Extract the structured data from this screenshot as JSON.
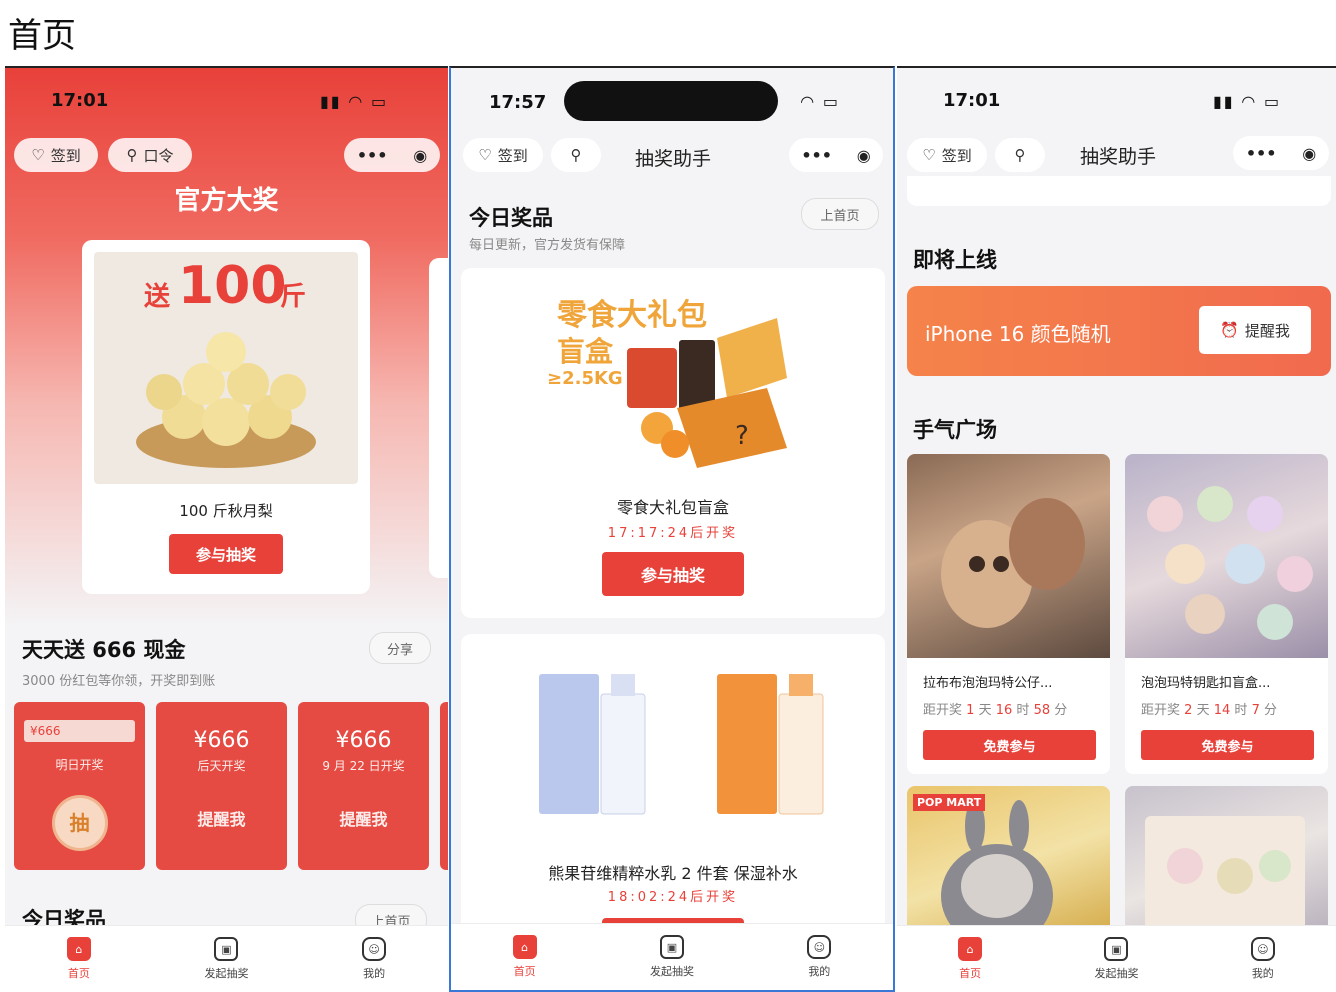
{
  "page_title": "首页",
  "phone1": {
    "status_time": "17:01",
    "nav_checkin": "签到",
    "nav_code": "口令",
    "header_title": "官方大奖",
    "prize_banner_prefix": "送",
    "prize_banner_amount": "100",
    "prize_banner_unit": "斤",
    "prize_name": "100 斤秋月梨",
    "join_label": "参与抽奖",
    "cash_title": "天天送 666 现金",
    "share_label": "分享",
    "cash_sub": "3000 份红包等你领，开奖即到账",
    "envelopes": [
      {
        "amount": "¥666",
        "sub": "明日开奖",
        "action": "抽"
      },
      {
        "amount": "¥666",
        "sub": "后天开奖",
        "action": "提醒我"
      },
      {
        "amount": "¥666",
        "sub": "9 月 22 日开奖",
        "action": "提醒我"
      }
    ],
    "today_title": "今日奖品",
    "today_pill": "上首页"
  },
  "phone2": {
    "status_time": "17:57",
    "nav_checkin": "签到",
    "nav_title": "抽奖助手",
    "today_title": "今日奖品",
    "today_pill": "上首页",
    "today_sub": "每日更新，官方发货有保障",
    "prize1_banner_line1": "零食大礼包",
    "prize1_banner_line2": "盲盒",
    "prize1_banner_weight": "≥2.5KG",
    "prize1_name": "零食大礼包盲盒",
    "prize1_countdown": "17:17:24后开奖",
    "join_label": "参与抽奖",
    "prize2_name": "熊果苷维精粹水乳 2 件套 保湿补水",
    "prize2_countdown": "18:02:24后开奖"
  },
  "phone3": {
    "status_time": "17:01",
    "nav_checkin": "签到",
    "nav_title": "抽奖助手",
    "upcoming_title": "即将上线",
    "upcoming_item": "iPhone 16 颜色随机",
    "remind_label": "提醒我",
    "plaza_title": "手气广场",
    "lucky": [
      {
        "name": "拉布布泡泡玛特公仔...",
        "rem_prefix": "距开奖",
        "d": "1",
        "h": "16",
        "m": "58",
        "free": "免费参与"
      },
      {
        "name": "泡泡玛特钥匙扣盲盒...",
        "rem_prefix": "距开奖",
        "d": "2",
        "h": "14",
        "m": "7",
        "free": "免费参与"
      }
    ],
    "popmart_badge": "POP MART"
  },
  "tabbar": {
    "home": "首页",
    "launch": "发起抽奖",
    "mine": "我的"
  },
  "units": {
    "day": "天",
    "hour": "时",
    "minute": "分"
  },
  "colors": {
    "accent": "#e8413a",
    "orange_gradient_start": "#f5834a",
    "header_red": "#e8413a"
  },
  "icons": [
    "heart-icon",
    "key-icon",
    "search-icon",
    "more-dots-icon",
    "target-icon",
    "home-icon",
    "gift-box-icon",
    "smiley-icon",
    "alarm-clock-icon"
  ]
}
